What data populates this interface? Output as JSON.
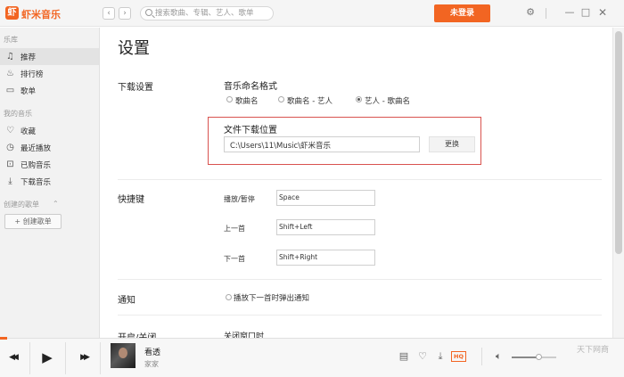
{
  "app": {
    "name": "虾米音乐",
    "logo_glyph": "虾",
    "accent": "#f26522"
  },
  "titlebar": {
    "back": "‹",
    "forward": "›",
    "search_placeholder": "搜索歌曲、专辑、艺人、歌单",
    "login_label": "未登录"
  },
  "sidebar": {
    "library_heading": "乐库",
    "library_items": [
      {
        "label": "推荐",
        "icon": "music-note-icon",
        "glyph": "♫",
        "active": true
      },
      {
        "label": "排行榜",
        "icon": "flame-icon",
        "glyph": "♨",
        "active": false
      },
      {
        "label": "歌单",
        "icon": "playlist-icon",
        "glyph": "▭",
        "active": false
      }
    ],
    "my_music_heading": "我的音乐",
    "my_music_items": [
      {
        "label": "收藏",
        "icon": "heart-icon",
        "glyph": "♡"
      },
      {
        "label": "最近播放",
        "icon": "clock-icon",
        "glyph": "◷"
      },
      {
        "label": "已购音乐",
        "icon": "cart-icon",
        "glyph": "⊡"
      },
      {
        "label": "下载音乐",
        "icon": "download-icon",
        "glyph": "⤓"
      }
    ],
    "created_heading": "创建的歌单",
    "created_caret": "⌃",
    "create_button": "+ 创建歌单"
  },
  "settings": {
    "title": "设置",
    "download": {
      "section_label": "下载设置",
      "naming_title": "音乐命名格式",
      "naming_options": [
        {
          "label": "歌曲名",
          "selected": false
        },
        {
          "label": "歌曲名 - 艺人",
          "selected": false
        },
        {
          "label": "艺人 - 歌曲名",
          "selected": true
        }
      ],
      "location_title": "文件下载位置",
      "location_value": "C:\\Users\\11\\Music\\虾米音乐",
      "change_button": "更换"
    },
    "shortcuts": {
      "section_label": "快捷键",
      "items": [
        {
          "label": "播放/暂停",
          "value": "Space"
        },
        {
          "label": "上一首",
          "value": "Shift+Left"
        },
        {
          "label": "下一首",
          "value": "Shift+Right"
        }
      ]
    },
    "notify": {
      "section_label": "通知",
      "option_label": "播放下一首时弹出通知",
      "checked": false
    },
    "startup": {
      "section_label": "开启/关闭",
      "option_label": "关闭窗口时"
    }
  },
  "player": {
    "prev_glyph": "◀◀",
    "play_glyph": "▶",
    "next_glyph": "▶▶",
    "song_title": "看透",
    "song_artist": "家家",
    "hq_label": "HQ",
    "volume_level": 0.6,
    "progress": 0.01
  },
  "watermark": "天下网商"
}
